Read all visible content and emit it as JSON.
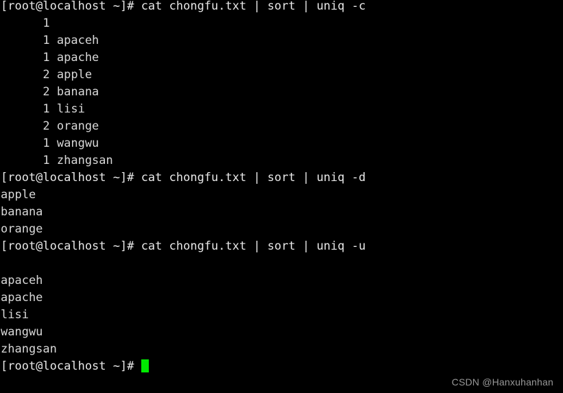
{
  "terminal": {
    "background_color": "#000000",
    "text_color": "#d8d8d8",
    "cursor_color": "#00ea00",
    "prompt": "[root@localhost ~]#",
    "lines": [
      {
        "type": "command",
        "text": "[root@localhost ~]# cat chongfu.txt | sort | uniq -c"
      },
      {
        "type": "output",
        "text": "      1"
      },
      {
        "type": "output",
        "text": "      1 apaceh"
      },
      {
        "type": "output",
        "text": "      1 apache"
      },
      {
        "type": "output",
        "text": "      2 apple"
      },
      {
        "type": "output",
        "text": "      2 banana"
      },
      {
        "type": "output",
        "text": "      1 lisi"
      },
      {
        "type": "output",
        "text": "      2 orange"
      },
      {
        "type": "output",
        "text": "      1 wangwu"
      },
      {
        "type": "output",
        "text": "      1 zhangsan"
      },
      {
        "type": "command",
        "text": "[root@localhost ~]# cat chongfu.txt | sort | uniq -d"
      },
      {
        "type": "output",
        "text": "apple"
      },
      {
        "type": "output",
        "text": "banana"
      },
      {
        "type": "output",
        "text": "orange"
      },
      {
        "type": "command",
        "text": "[root@localhost ~]# cat chongfu.txt | sort | uniq -u"
      },
      {
        "type": "output",
        "text": ""
      },
      {
        "type": "output",
        "text": "apaceh"
      },
      {
        "type": "output",
        "text": "apache"
      },
      {
        "type": "output",
        "text": "lisi"
      },
      {
        "type": "output",
        "text": "wangwu"
      },
      {
        "type": "output",
        "text": "zhangsan"
      }
    ],
    "final_prompt": "[root@localhost ~]# "
  },
  "watermark": {
    "text": "CSDN @Hanxuhanhan"
  }
}
